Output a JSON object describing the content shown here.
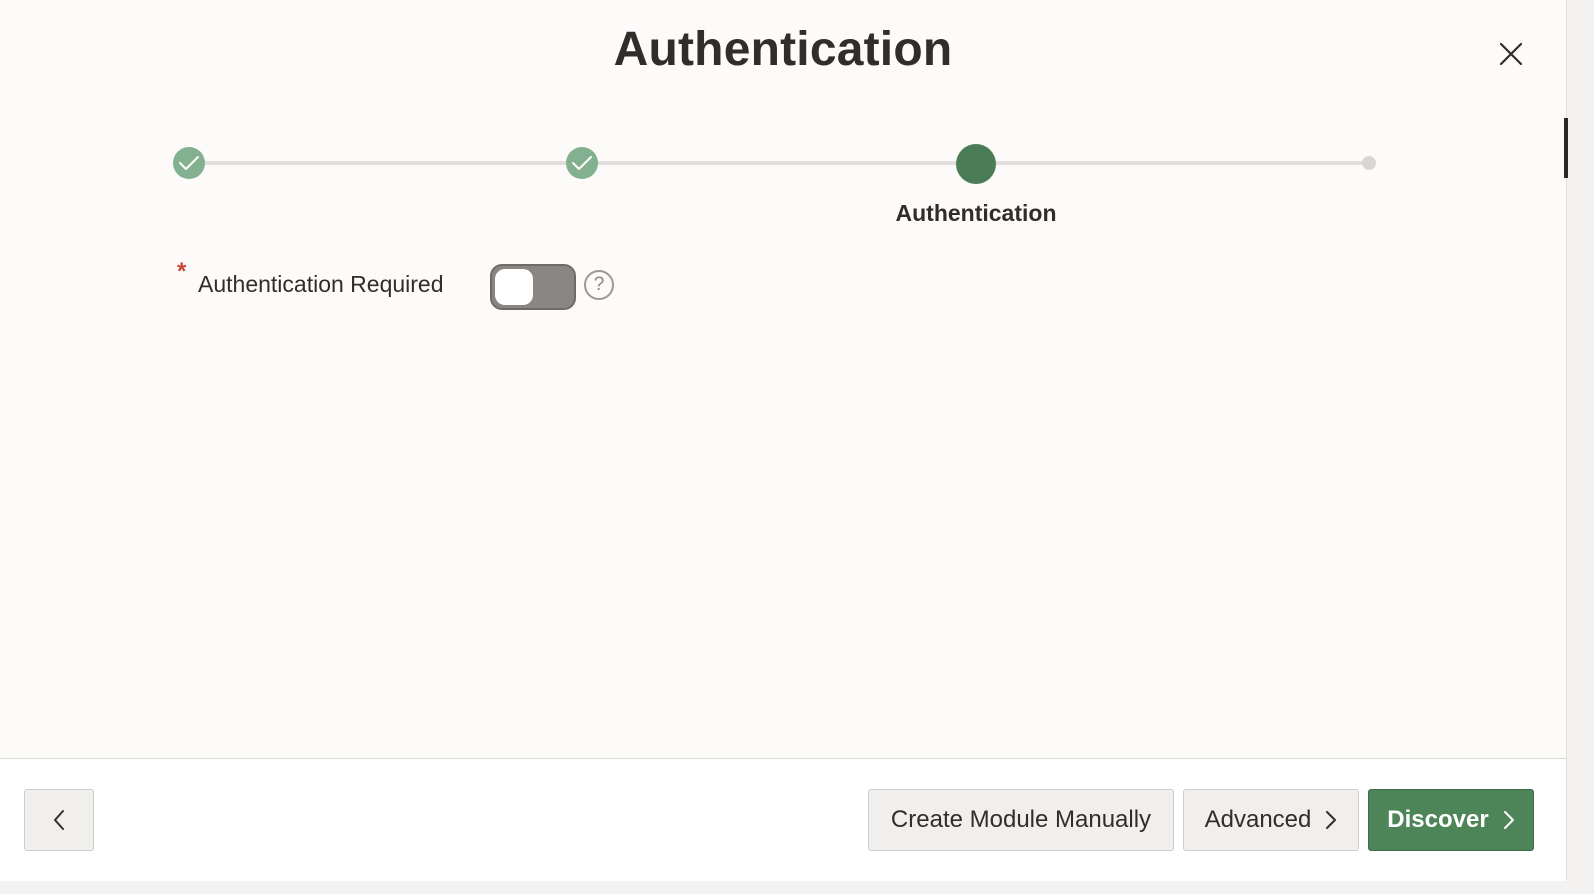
{
  "dialog": {
    "title": "Authentication",
    "close_icon": "close-icon"
  },
  "train": {
    "steps": [
      {
        "status": "complete",
        "icon": "check-icon"
      },
      {
        "status": "complete",
        "icon": "check-icon"
      },
      {
        "status": "current",
        "label": "Authentication"
      },
      {
        "status": "future"
      }
    ],
    "colors": {
      "complete": "#83b08e",
      "current": "#4b7c56",
      "future": "#d8d6d3"
    }
  },
  "form": {
    "required_marker": "*",
    "auth_required_label": "Authentication Required",
    "auth_required_value": false,
    "help_icon": "help-icon",
    "help_glyph": "?"
  },
  "footer": {
    "back_icon": "chevron-left-icon",
    "create_manually_label": "Create Module Manually",
    "advanced_label": "Advanced",
    "discover_label": "Discover",
    "accent": "#4e8558"
  }
}
